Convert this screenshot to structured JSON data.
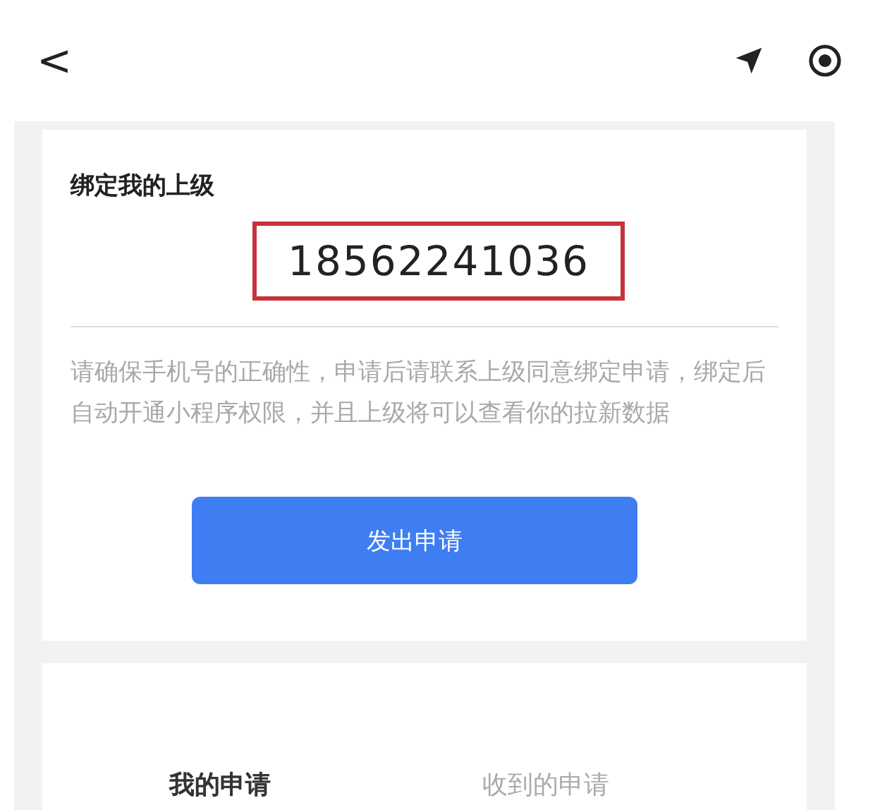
{
  "nav_bar": {
    "back": "<"
  },
  "bind_card": {
    "title": "绑定我的上级",
    "phone": "18562241036",
    "notice": "请确保手机号的正确性，申请后请联系上级同意绑定申请，绑定后自动开通小程序权限，并且上级将可以查看你的拉新数据",
    "button": "发出申请"
  },
  "tabs": [
    {
      "label": "我的申请",
      "selected": true
    },
    {
      "label": "收到的申请",
      "selected": false
    }
  ]
}
